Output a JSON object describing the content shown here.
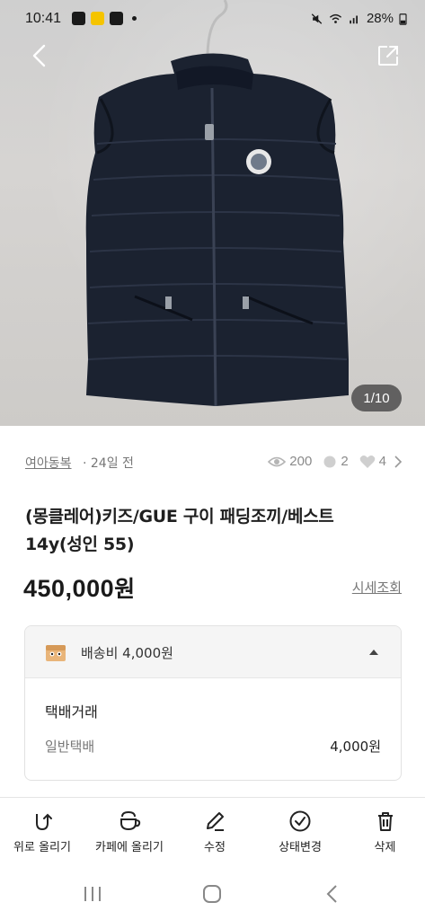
{
  "status_bar": {
    "time": "10:41",
    "battery": "28%",
    "icons": [
      "gallery-icon",
      "app-icon",
      "hd-voice-icon",
      "mute-icon",
      "wifi-icon",
      "signal-icon",
      "battery-icon"
    ]
  },
  "photo": {
    "counter": "1/10",
    "description_icon": "vest-photo"
  },
  "meta": {
    "category": "여아동복",
    "time_ago": "· 24일 전",
    "views": "200",
    "chats": "2",
    "likes": "4"
  },
  "product": {
    "title_line1": "(몽클레어)키즈/GUE 구이 패딩조끼/베스트",
    "title_line2": "14y(성인 55)",
    "price": "450,000",
    "price_unit": "원",
    "market_link": "시세조회"
  },
  "shipping": {
    "header": "배송비 4,000원",
    "type": "택배거래",
    "option": "일반택배",
    "fee": "4,000원"
  },
  "toolbar": {
    "items": [
      {
        "label": "위로 올리기",
        "icon": "bump-up-icon"
      },
      {
        "label": "카페에 올리기",
        "icon": "cafe-icon"
      },
      {
        "label": "수정",
        "icon": "edit-icon"
      },
      {
        "label": "상태변경",
        "icon": "status-check-icon"
      },
      {
        "label": "삭제",
        "icon": "trash-icon"
      }
    ]
  },
  "colors": {
    "accent_text": "#1f1f1f",
    "muted": "#777777",
    "card_header_bg": "#f5f5f5",
    "vest": "#1b2230"
  }
}
